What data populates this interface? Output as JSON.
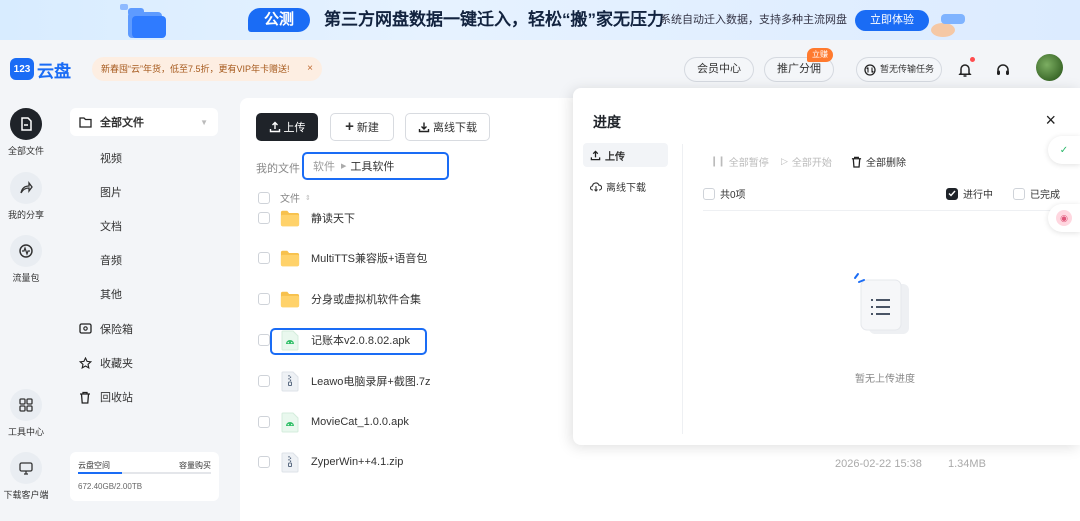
{
  "banner": {
    "tag": "公测",
    "headline": "第三方网盘数据一键迁入，轻松“搬”家无压力",
    "sub": "系统自动迁入数据，支持多种主流网盘",
    "cta": "立即体验"
  },
  "header": {
    "logo_mark": "123",
    "logo_name": "云盘",
    "promo": "新春囤“云”年货，低至7.5折，更有VIP年卡赠送!",
    "promo_close": "×",
    "member_center": "会员中心",
    "referral": "推广分佣",
    "referral_badge": "立赚",
    "transfer_task": "暂无传输任务"
  },
  "rail": [
    {
      "label": "全部文件",
      "icon": "file-icon"
    },
    {
      "label": "我的分享",
      "icon": "share-icon"
    },
    {
      "label": "流量包",
      "icon": "traffic-icon"
    },
    {
      "label": "工具中心",
      "icon": "grid-icon"
    },
    {
      "label": "下载客户端",
      "icon": "monitor-icon"
    }
  ],
  "sidebar": {
    "all_files": "全部文件",
    "sub_items": [
      "视频",
      "图片",
      "文档",
      "音频",
      "其他"
    ],
    "safe": "保险箱",
    "favorites": "收藏夹",
    "recycle": "回收站"
  },
  "storage": {
    "label": "云盘空间",
    "buy": "容量购买",
    "used": "672.40GB/2.00TB",
    "fraction": 0.33
  },
  "toolbar": {
    "upload": "上传",
    "new": "新建",
    "offline": "离线下载"
  },
  "breadcrumb": {
    "root": "我的文件",
    "parent": "软件",
    "current": "工具软件"
  },
  "file_list": {
    "col_name": "文件",
    "files": [
      {
        "name": "静读天下",
        "type": "folder"
      },
      {
        "name": "MultiTTS兼容版+语音包",
        "type": "folder"
      },
      {
        "name": "分身或虚拟机软件合集",
        "type": "folder"
      },
      {
        "name": "记账本v2.0.8.02.apk",
        "type": "apk"
      },
      {
        "name": "Leawo电脑录屏+截图.7z",
        "type": "zip"
      },
      {
        "name": "MovieCat_1.0.0.apk",
        "type": "apk"
      },
      {
        "name": "ZyperWin++4.1.zip",
        "type": "zip",
        "date": "2026-02-22 15:38",
        "size": "1.34MB"
      }
    ]
  },
  "progress_panel": {
    "title": "进度",
    "close": "×",
    "tabs": [
      "上传",
      "离线下载"
    ],
    "actions": {
      "pause_all": "全部暂停",
      "start_all": "全部开始",
      "delete_all": "全部删除"
    },
    "count": "共0项",
    "filter_ongoing": "进行中",
    "filter_done": "已完成",
    "empty": "暂无上传进度"
  },
  "colors": {
    "accent": "#1a6cf5",
    "dark": "#1f2329",
    "highlight_border": "#1a6cf5"
  }
}
